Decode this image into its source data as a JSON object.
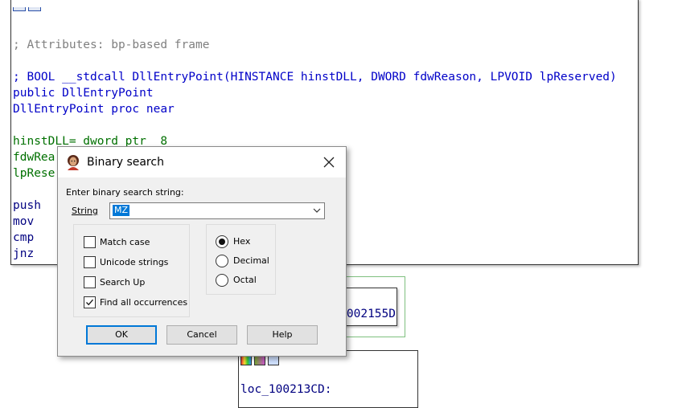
{
  "code": {
    "lines": [
      "; Attributes: bp-based frame",
      "; BOOL __stdcall DllEntryPoint(HINSTANCE hinstDLL, DWORD fdwReason, LPVOID lpReserved)",
      "public DllEntryPoint",
      "DllEntryPoint proc near",
      "hinstDLL= dword ptr  8",
      "fdwRea",
      "lpRese",
      "push",
      "mov",
      "cmp",
      "jnz"
    ]
  },
  "graph": {
    "node_a_text": "0002155D",
    "node_b_text": "loc_100213CD:"
  },
  "dialog": {
    "title": "Binary search",
    "prompt": "Enter binary search string:",
    "string_label": "String",
    "string_value": "MZ",
    "options": [
      {
        "label": "Match case",
        "checked": false
      },
      {
        "label": "Unicode strings",
        "checked": false
      },
      {
        "label": "Search Up",
        "checked": false
      },
      {
        "label": "Find all occurrences",
        "checked": true
      }
    ],
    "radix": [
      {
        "label": "Hex",
        "selected": true
      },
      {
        "label": "Decimal",
        "selected": false
      },
      {
        "label": "Octal",
        "selected": false
      }
    ],
    "buttons": {
      "ok": "OK",
      "cancel": "Cancel",
      "help": "Help"
    }
  }
}
